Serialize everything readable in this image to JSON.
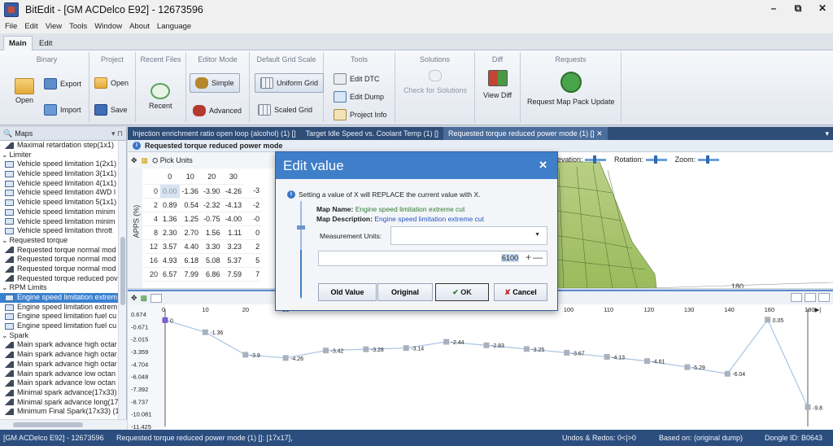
{
  "window": {
    "title": "BitEdit - [GM ACDelco E92] - 12673596",
    "controls": [
      "–",
      "⧉",
      "✕"
    ]
  },
  "menu": [
    "File",
    "Edit",
    "View",
    "Tools",
    "Window",
    "About",
    "Language"
  ],
  "ribbon_tabs": [
    "Main",
    "Edit"
  ],
  "ribbon": {
    "binary": {
      "title": "Binary",
      "open": "Open",
      "export": "Export",
      "import": "Import"
    },
    "project": {
      "title": "Project",
      "open": "Open",
      "save": "Save"
    },
    "recent_files": {
      "title": "Recent Files",
      "recent": "Recent"
    },
    "editor_mode": {
      "title": "Editor Mode",
      "simple": "Simple",
      "advanced": "Advanced"
    },
    "grid_scale": {
      "title": "Default Grid Scale",
      "uniform": "Uniform Grid",
      "scaled": "Scaled Grid"
    },
    "tools": {
      "title": "Tools",
      "edit_dtc": "Edit DTC",
      "edit_dump": "Edit Dump",
      "project_info": "Project Info"
    },
    "solutions": {
      "title": "Solutions",
      "check": "Check for Solutions"
    },
    "diff": {
      "title": "Diff",
      "view": "View Diff"
    },
    "requests": {
      "title": "Requests",
      "request": "Request Map Pack Update"
    }
  },
  "sidebar": {
    "header": "Maps",
    "pin": "▾ ⊓",
    "rows": [
      {
        "kind": "item",
        "icon": "3d",
        "label": "Maximal retardation step(1x1)"
      },
      {
        "kind": "cat",
        "label": "Limiter"
      },
      {
        "kind": "item",
        "icon": "table",
        "label": "Vehicle speed limitation 1(2x1)"
      },
      {
        "kind": "item",
        "icon": "table",
        "label": "Vehicle speed limitation 3(1x1)"
      },
      {
        "kind": "item",
        "icon": "table",
        "label": "Vehicle speed limitation 4(1x1)"
      },
      {
        "kind": "item",
        "icon": "table",
        "label": "Vehicle speed limitation 4WD l"
      },
      {
        "kind": "item",
        "icon": "table",
        "label": "Vehicle speed limitation 5(1x1)"
      },
      {
        "kind": "item",
        "icon": "table",
        "label": "Vehicle speed limitation minim"
      },
      {
        "kind": "item",
        "icon": "table",
        "label": "Vehicle speed limitation minim"
      },
      {
        "kind": "item",
        "icon": "table",
        "label": "Vehicle speed limitation thrott"
      },
      {
        "kind": "cat",
        "label": "Requested torque"
      },
      {
        "kind": "item",
        "icon": "3d",
        "label": "Requested torque normal mod"
      },
      {
        "kind": "item",
        "icon": "3d",
        "label": "Requested torque normal mod"
      },
      {
        "kind": "item",
        "icon": "3d",
        "label": "Requested torque normal mod"
      },
      {
        "kind": "item",
        "icon": "3d",
        "label": "Requested torque reduced pov"
      },
      {
        "kind": "cat",
        "label": "RPM Limits"
      },
      {
        "kind": "item",
        "icon": "table",
        "label": "Engine speed limitation extrem",
        "selected": true
      },
      {
        "kind": "item",
        "icon": "table",
        "label": "Engine speed limitation extrem"
      },
      {
        "kind": "item",
        "icon": "table",
        "label": "Engine speed limitation fuel cu"
      },
      {
        "kind": "item",
        "icon": "table",
        "label": "Engine speed limitation fuel cu"
      },
      {
        "kind": "cat",
        "label": "Spark"
      },
      {
        "kind": "item",
        "icon": "3d",
        "label": "Main spark advance high octar"
      },
      {
        "kind": "item",
        "icon": "3d",
        "label": "Main spark advance high octar"
      },
      {
        "kind": "item",
        "icon": "3d",
        "label": "Main spark advance high octar"
      },
      {
        "kind": "item",
        "icon": "3d",
        "label": "Main spark advance low octan"
      },
      {
        "kind": "item",
        "icon": "3d",
        "label": "Main spark advance low octan"
      },
      {
        "kind": "item",
        "icon": "3d",
        "label": "Minimal spark advance(17x33)"
      },
      {
        "kind": "item",
        "icon": "3d",
        "label": "Minimal spark advance long(17"
      },
      {
        "kind": "item",
        "icon": "3d",
        "label": "Minimum Final Spark(17x33) (1"
      }
    ]
  },
  "doc_tabs": [
    {
      "label": "Injection enrichment ratio open loop (alcohol) (1) []",
      "active": false
    },
    {
      "label": "Target Idle Speed vs. Coolant Temp (1) []",
      "active": false
    },
    {
      "label": "Requested torque reduced power mode (1) []",
      "active": true
    }
  ],
  "doc_tab_close": "✕",
  "doc_tab_overflow": "▾",
  "map": {
    "title": "Requested torque reduced power mode",
    "pick_units": "Pick Units",
    "apps_label": "APPS (%)",
    "col_headers": [
      "0",
      "10",
      "20",
      "30"
    ],
    "rows": [
      {
        "h": "0",
        "v": [
          "0.00",
          "-1.36",
          "-3.90",
          "-4.26",
          "-3"
        ]
      },
      {
        "h": "2",
        "v": [
          "0.89",
          "0.54",
          "-2.32",
          "-4.13",
          "-2"
        ]
      },
      {
        "h": "4",
        "v": [
          "1.36",
          "1.25",
          "-0.75",
          "-4.00",
          "-0"
        ]
      },
      {
        "h": "8",
        "v": [
          "2.30",
          "2.70",
          "1.56",
          "1.11",
          "0"
        ]
      },
      {
        "h": "12",
        "v": [
          "3.57",
          "4.40",
          "3.30",
          "3.23",
          "2"
        ]
      },
      {
        "h": "16",
        "v": [
          "4.93",
          "6.18",
          "5.08",
          "5.37",
          "5"
        ]
      },
      {
        "h": "20",
        "v": [
          "6.57",
          "7.99",
          "6.86",
          "7.59",
          "7"
        ]
      }
    ],
    "view3d": {
      "elevation": "Elevation:",
      "rotation": "Rotation:",
      "zoom": "Zoom:",
      "axis_tick": "180"
    }
  },
  "dialog": {
    "title": "Edit value",
    "close": "✕",
    "message": "Setting a value of X will REPLACE the current value with X.",
    "map_name_label": "Map Name:",
    "map_name": "Engine speed limitation extreme cut",
    "map_desc_label": "Map Description:",
    "map_desc": "Engine speed limitation extreme cut",
    "units_label": "Measurement Units:",
    "units_value": "",
    "value": "6100",
    "plus_minus": "+—",
    "buttons": {
      "old": "Old Value",
      "original": "Original",
      "ok": "✔ OK",
      "cancel": "✘ Cancel"
    },
    "ok_color": "#2e7d32",
    "cancel_color": "#c62828"
  },
  "chart_data": {
    "type": "line",
    "x": [
      0,
      10,
      20,
      30,
      40,
      50,
      60,
      70,
      80,
      90,
      100,
      110,
      120,
      130,
      140,
      160,
      180
    ],
    "x_labels": [
      "0",
      "10",
      "20",
      "30",
      "",
      "",
      "",
      "",
      "",
      "",
      "100",
      "110",
      "120",
      "130",
      "140",
      "160",
      "180▶|"
    ],
    "values": [
      0,
      -1.36,
      -3.9,
      -4.26,
      -3.42,
      -3.28,
      -3.14,
      -2.44,
      -2.83,
      -3.25,
      -3.67,
      -4.13,
      -4.61,
      -5.29,
      -6.04,
      0.05,
      -9.8
    ],
    "value_labels": [
      "0",
      "-1.36",
      "-3.9",
      "-4.26",
      "-3.42",
      "-3.28",
      "-3.14",
      "-2.44",
      "-2.83",
      "-3.25",
      "-3.67",
      "-4.13",
      "-4.61",
      "-5.29",
      "-6.04",
      "0.05",
      "-9.8"
    ],
    "y_ticks": [
      "0.674",
      "-0.671",
      "-2.015",
      "-3.359",
      "-4.704",
      "-6.048",
      "-7.392",
      "-8.737",
      "-10.081",
      "-11.425"
    ],
    "ylim": [
      -11.425,
      0.674
    ],
    "line_color": "#a9c4e4",
    "marker_color": "#a8b2bf",
    "selected_color": "#7a5fd1",
    "grid": false
  },
  "status": {
    "ecu": "[GM ACDelco E92] - 12673596",
    "map": "Requested torque reduced power mode (1) []: [17x17],",
    "undo": "Undos & Redos: 0<|>0",
    "based": "Based on: (original dump)",
    "dongle": "Dongle ID: B0643"
  }
}
